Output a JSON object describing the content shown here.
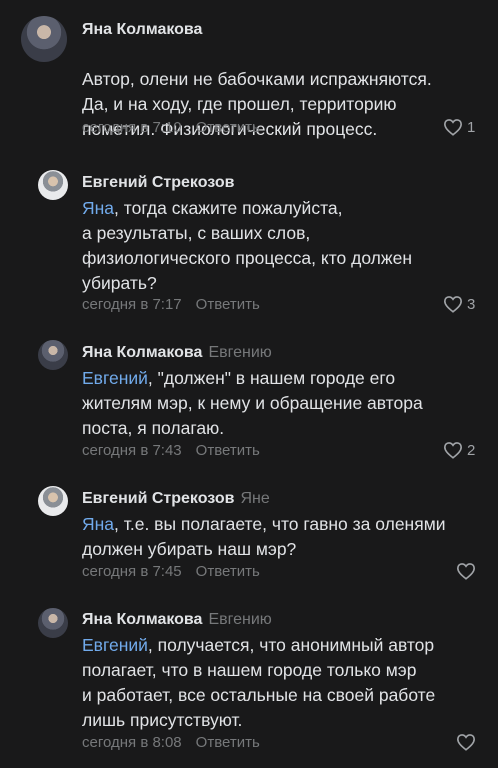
{
  "comments": [
    {
      "author": "Яна Колмакова",
      "reply_to": "",
      "mention": "",
      "text": "Автор, олени не бабочками испражняются.\nДа, и на ходу, где прошел, территорию\nпометил. Физиологический процесс.",
      "time": "сегодня в 7:10",
      "reply_label": "Ответить",
      "likes": "1"
    },
    {
      "author": "Евгений Стрекозов",
      "reply_to": "",
      "mention": "Яна",
      "text": ", тогда скажите пожалуйста,\nа  результаты, с ваших слов,\nфизиологического процесса, кто должен\nубирать?",
      "time": "сегодня в 7:17",
      "reply_label": "Ответить",
      "likes": "3"
    },
    {
      "author": "Яна Колмакова",
      "reply_to": "Евгению",
      "mention": "Евгений",
      "text": ", \"должен\" в нашем городе его\nжителям мэр, к нему и обращение автора\nпоста, я полагаю.",
      "time": "сегодня в 7:43",
      "reply_label": "Ответить",
      "likes": "2"
    },
    {
      "author": "Евгений Стрекозов",
      "reply_to": "Яне",
      "mention": "Яна",
      "text": ", т.е. вы полагаете, что гавно за оленями\nдолжен убирать наш мэр?",
      "time": "сегодня в 7:45",
      "reply_label": "Ответить",
      "likes": ""
    },
    {
      "author": "Яна Колмакова",
      "reply_to": "Евгению",
      "mention": "Евгений",
      "text": ", получается, что анонимный автор\nполагает, что в нашем городе только мэр\nи работает, все остальные на своей работе\nлишь присутствуют.",
      "time": "сегодня в 8:08",
      "reply_label": "Ответить",
      "likes": ""
    }
  ],
  "icons": {
    "like": "heart-outline-icon"
  },
  "colors": {
    "background": "#19191a",
    "text": "#e1e3e6",
    "secondary": "#76787a",
    "link": "#71aaeb"
  }
}
